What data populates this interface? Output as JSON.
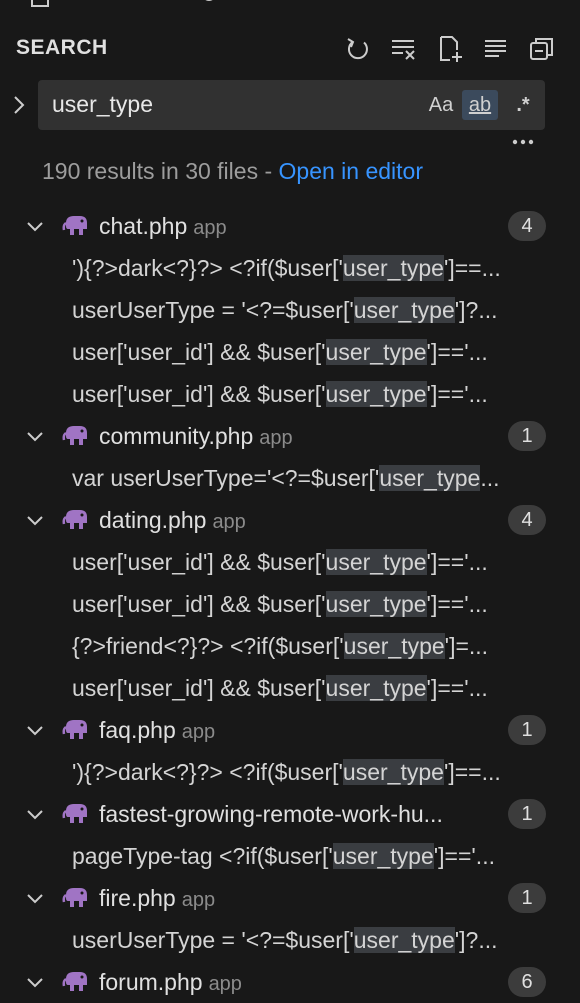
{
  "header": {
    "title": "SEARCH"
  },
  "search": {
    "query": "user_type",
    "opt_case": "Aa",
    "opt_word": "ab",
    "opt_regex": ".*"
  },
  "summary": {
    "text": "190 results in 30 files - ",
    "link": "Open in editor"
  },
  "files": [
    {
      "name": "chat.php",
      "dir": "app",
      "count": "4",
      "matches": [
        {
          "pre": "'){?>dark<?}?> <?if($user['",
          "hit": "user_type",
          "post": "']==..."
        },
        {
          "pre": "userUserType = '<?=$user['",
          "hit": "user_type",
          "post": "']?..."
        },
        {
          "pre": "user['user_id'] && $user['",
          "hit": "user_type",
          "post": "']=='..."
        },
        {
          "pre": "user['user_id'] && $user['",
          "hit": "user_type",
          "post": "']=='..."
        }
      ]
    },
    {
      "name": "community.php",
      "dir": "app",
      "count": "1",
      "matches": [
        {
          "pre": "var userUserType='<?=$user['",
          "hit": "user_type",
          "post": "..."
        }
      ]
    },
    {
      "name": "dating.php",
      "dir": "app",
      "count": "4",
      "matches": [
        {
          "pre": "user['user_id'] && $user['",
          "hit": "user_type",
          "post": "']=='..."
        },
        {
          "pre": "user['user_id'] && $user['",
          "hit": "user_type",
          "post": "']=='..."
        },
        {
          "pre": "{?>friend<?}?> <?if($user['",
          "hit": "user_type",
          "post": "']=..."
        },
        {
          "pre": "user['user_id'] && $user['",
          "hit": "user_type",
          "post": "']=='..."
        }
      ]
    },
    {
      "name": "faq.php",
      "dir": "app",
      "count": "1",
      "matches": [
        {
          "pre": "'){?>dark<?}?> <?if($user['",
          "hit": "user_type",
          "post": "']==..."
        }
      ]
    },
    {
      "name": "fastest-growing-remote-work-hu...",
      "dir": "",
      "count": "1",
      "matches": [
        {
          "pre": "pageType-tag <?if($user['",
          "hit": "user_type",
          "post": "']=='..."
        }
      ]
    },
    {
      "name": "fire.php",
      "dir": "app",
      "count": "1",
      "matches": [
        {
          "pre": "userUserType = '<?=$user['",
          "hit": "user_type",
          "post": "']?..."
        }
      ]
    },
    {
      "name": "forum.php",
      "dir": "app",
      "count": "6",
      "matches": []
    }
  ],
  "icons": {
    "file_icon": "php-elephant-icon",
    "accent": "#3794ff",
    "php_color": "#a074c4"
  }
}
